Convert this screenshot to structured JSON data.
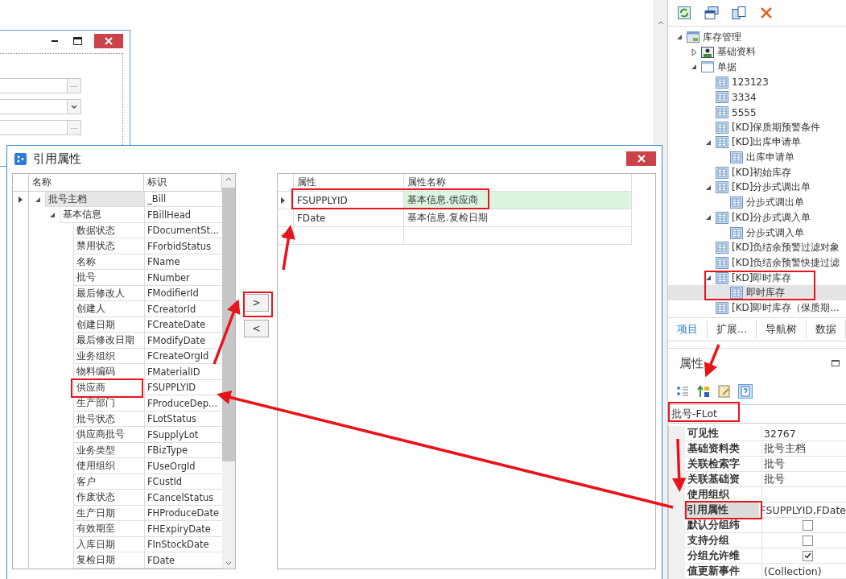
{
  "back_window": {
    "fields": [
      {
        "kind": "ellipsis",
        "button": "···"
      },
      {
        "kind": "dropdown"
      },
      {
        "kind": "ellipsis",
        "button": "···"
      }
    ]
  },
  "dialog": {
    "title": "引用属性",
    "source_grid": {
      "columns": [
        "名称",
        "标识"
      ],
      "rows": [
        {
          "name": "批号主档",
          "id": "_Bill",
          "selected": true,
          "expanded": true,
          "children": [
            {
              "name": "基本信息",
              "id": "FBillHead",
              "selected": false,
              "expanded": true,
              "children": [
                {
                  "name": "数据状态",
                  "id": "FDocumentSt...",
                  "selected": false
                },
                {
                  "name": "禁用状态",
                  "id": "FForbidStatus",
                  "selected": false
                },
                {
                  "name": "名称",
                  "id": "FName",
                  "selected": false
                },
                {
                  "name": "批号",
                  "id": "FNumber",
                  "selected": false
                },
                {
                  "name": "最后修改人",
                  "id": "FModifierId",
                  "selected": false
                },
                {
                  "name": "创建人",
                  "id": "FCreatorId",
                  "selected": false
                },
                {
                  "name": "创建日期",
                  "id": "FCreateDate",
                  "selected": false
                },
                {
                  "name": "最后修改日期",
                  "id": "FModifyDate",
                  "selected": false
                },
                {
                  "name": "业务组织",
                  "id": "FCreateOrgId",
                  "selected": false
                },
                {
                  "name": "物料编码",
                  "id": "FMaterialID",
                  "selected": false
                },
                {
                  "name": "供应商",
                  "id": "FSUPPLYID",
                  "selected": false
                },
                {
                  "name": "生产部门",
                  "id": "FProduceDep...",
                  "selected": false
                },
                {
                  "name": "批号状态",
                  "id": "FLotStatus",
                  "selected": false
                },
                {
                  "name": "供应商批号",
                  "id": "FSupplyLot",
                  "selected": false
                },
                {
                  "name": "业务类型",
                  "id": "FBizType",
                  "selected": false
                },
                {
                  "name": "使用组织",
                  "id": "FUseOrgId",
                  "selected": false
                },
                {
                  "name": "客户",
                  "id": "FCustId",
                  "selected": false
                },
                {
                  "name": "作废状态",
                  "id": "FCancelStatus",
                  "selected": false
                },
                {
                  "name": "生产日期",
                  "id": "FHProduceDate",
                  "selected": false
                },
                {
                  "name": "有效期至",
                  "id": "FHExpiryDate",
                  "selected": false
                },
                {
                  "name": "入库日期",
                  "id": "FInStockDate",
                  "selected": false
                },
                {
                  "name": "复检日期",
                  "id": "FDate",
                  "selected": false
                }
              ]
            }
          ]
        }
      ]
    },
    "move_buttons": [
      ">",
      "<"
    ],
    "target_grid": {
      "columns": [
        "属性",
        "属性名称"
      ],
      "rows": [
        {
          "attr": "FSUPPLYID",
          "name": "基本信息.供应商",
          "selected": true
        },
        {
          "attr": "FDate",
          "name": "基本信息.复检日期",
          "selected": false
        }
      ]
    }
  },
  "nav_tree": [
    {
      "label": "库存管理",
      "kind": "module",
      "expanded": true,
      "selected": false,
      "children": [
        {
          "label": "基础资料",
          "kind": "basedata",
          "expanded": false,
          "selected": false
        },
        {
          "label": "单据",
          "kind": "folder",
          "expanded": true,
          "selected": false,
          "children": [
            {
              "label": "123123",
              "kind": "form",
              "selected": false
            },
            {
              "label": "3334",
              "kind": "form",
              "selected": false
            },
            {
              "label": "5555",
              "kind": "form",
              "selected": false
            },
            {
              "label": "[KD]保质期预警条件",
              "kind": "form",
              "selected": false
            },
            {
              "label": "[KD]出库申请单",
              "kind": "form",
              "expanded": true,
              "selected": false,
              "children": [
                {
                  "label": "出库申请单",
                  "kind": "form",
                  "selected": false
                }
              ]
            },
            {
              "label": "[KD]初始库存",
              "kind": "form",
              "selected": false
            },
            {
              "label": "[KD]分步式调出单",
              "kind": "form",
              "expanded": true,
              "selected": false,
              "children": [
                {
                  "label": "分步式调出单",
                  "kind": "form",
                  "selected": false
                }
              ]
            },
            {
              "label": "[KD]分步式调入单",
              "kind": "form",
              "expanded": true,
              "selected": false,
              "children": [
                {
                  "label": "分步式调入单",
                  "kind": "form",
                  "selected": false
                }
              ]
            },
            {
              "label": "[KD]负结余预警过滤对象",
              "kind": "form",
              "selected": false
            },
            {
              "label": "[KD]负结余预警快捷过滤",
              "kind": "form",
              "selected": false
            },
            {
              "label": "[KD]即时库存",
              "kind": "form",
              "expanded": true,
              "selected": false,
              "children": [
                {
                  "label": "即时库存",
                  "kind": "form",
                  "selected": true
                }
              ]
            },
            {
              "label": "[KD]即时库存（保质期...",
              "kind": "form",
              "selected": false
            }
          ]
        }
      ]
    }
  ],
  "tabs": [
    {
      "label": "项目",
      "selected": true
    },
    {
      "label": "扩展...",
      "selected": false
    },
    {
      "label": "导航树",
      "selected": false
    },
    {
      "label": "数据",
      "selected": false
    }
  ],
  "properties": {
    "title": "属性",
    "object": "批号-FLot",
    "rows": [
      {
        "name": "可见性",
        "kind": "text",
        "value": "32767",
        "selected": false
      },
      {
        "name": "基础资料类",
        "kind": "text",
        "value": "批号主档",
        "selected": false
      },
      {
        "name": "关联检索字",
        "kind": "text",
        "value": "批号",
        "selected": false
      },
      {
        "name": "关联基础资",
        "kind": "text",
        "value": "批号",
        "selected": false
      },
      {
        "name": "使用组织",
        "kind": "text",
        "selected": false
      },
      {
        "name": "引用属性",
        "kind": "text",
        "value": "FSUPPLYID,FDate",
        "selected": true
      },
      {
        "name": "默认分组纬",
        "kind": "checkbox",
        "checked": false,
        "selected": false
      },
      {
        "name": "支持分组",
        "kind": "checkbox",
        "checked": false,
        "selected": false
      },
      {
        "name": "分组允许维",
        "kind": "checkbox",
        "checked": true,
        "selected": false
      },
      {
        "name": "值更新事件",
        "kind": "text",
        "value": "(Collection)",
        "selected": false
      }
    ]
  }
}
